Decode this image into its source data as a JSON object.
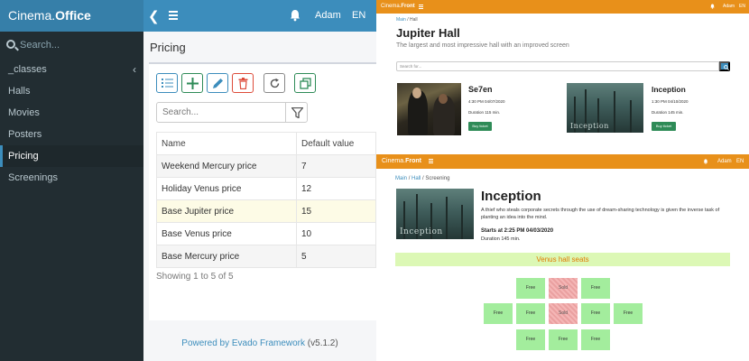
{
  "office": {
    "brand_prefix": "Cinema.",
    "brand_bold": "Office",
    "back_symbol": "❮",
    "user": "Adam",
    "lang": "EN",
    "search_placeholder": "Search...",
    "nav": [
      {
        "label": "_classes",
        "caret": "‹"
      },
      {
        "label": "Halls"
      },
      {
        "label": "Movies"
      },
      {
        "label": "Posters"
      },
      {
        "label": "Pricing",
        "selected": true
      },
      {
        "label": "Screenings"
      }
    ],
    "page_title": "Pricing",
    "toolbar_icons": [
      "list-icon",
      "plus-icon",
      "pencil-icon",
      "trash-icon",
      "refresh-icon",
      "copy-icon"
    ],
    "table_search_placeholder": "Search...",
    "columns": [
      "Name",
      "Default value"
    ],
    "rows": [
      [
        "Weekend Mercury price",
        "7"
      ],
      [
        "Holiday Venus price",
        "12"
      ],
      [
        "Base Jupiter price",
        "15"
      ],
      [
        "Base Venus price",
        "10"
      ],
      [
        "Base Mercury price",
        "5"
      ]
    ],
    "showing": "Showing 1 to 5 of 5",
    "footer_text": "Powered by Evado Framework",
    "footer_version": "(v5.1.2)",
    "colors": {
      "topbar": "#3c8dbc",
      "sidebar": "#222d32"
    }
  },
  "front_hall": {
    "brand_prefix": "Cinema.",
    "brand_bold": "Front",
    "user": "Adam",
    "lang": "EN",
    "breadcrumb": {
      "main": "Main",
      "sep": "/",
      "current": "Hall"
    },
    "title": "Jupiter Hall",
    "subtitle": "The largest and most impressive hall with an improved screen",
    "search_placeholder": "Search for...",
    "movies": [
      {
        "title": "Se7en",
        "time": "4:30 PM 04/07/2020",
        "duration": "Duration 115 min.",
        "button": "Buy ticket"
      },
      {
        "title": "Inception",
        "time": "1:30 PM 04/10/2020",
        "duration": "Duration 145 min.",
        "button": "Buy ticket",
        "poster_text": "Inception"
      }
    ],
    "colors": {
      "navbar": "#e8901a",
      "button": "#2e8b57"
    }
  },
  "front_screening": {
    "brand_prefix": "Cinema.",
    "brand_bold": "Front",
    "user": "Adam",
    "lang": "EN",
    "breadcrumb": {
      "main": "Main",
      "hall": "Hall",
      "current": "Screening",
      "sep": "/"
    },
    "title": "Inception",
    "poster_text": "Inception",
    "description": "A thief who steals corporate secrets through the use of dream-sharing technology is given the inverse task of planting an idea into the mind.",
    "starts": "Starts at 2:25 PM 04/03/2020",
    "duration": "Duration 145 min.",
    "hall_name": "Venus hall seats",
    "seats": [
      {
        "status": "Free"
      },
      {
        "status": "Sold"
      },
      {
        "status": "Free"
      },
      {
        "status": "Free"
      },
      {
        "status": "Free"
      },
      {
        "status": "Sold"
      },
      {
        "status": "Free"
      },
      {
        "status": "Free"
      },
      {
        "status": "Free"
      },
      {
        "status": "Free"
      },
      {
        "status": "Free"
      }
    ],
    "colors": {
      "free": "#a3ed9d",
      "sold": "#f4b6b6",
      "hall_bar": "#dcf8b5"
    }
  }
}
